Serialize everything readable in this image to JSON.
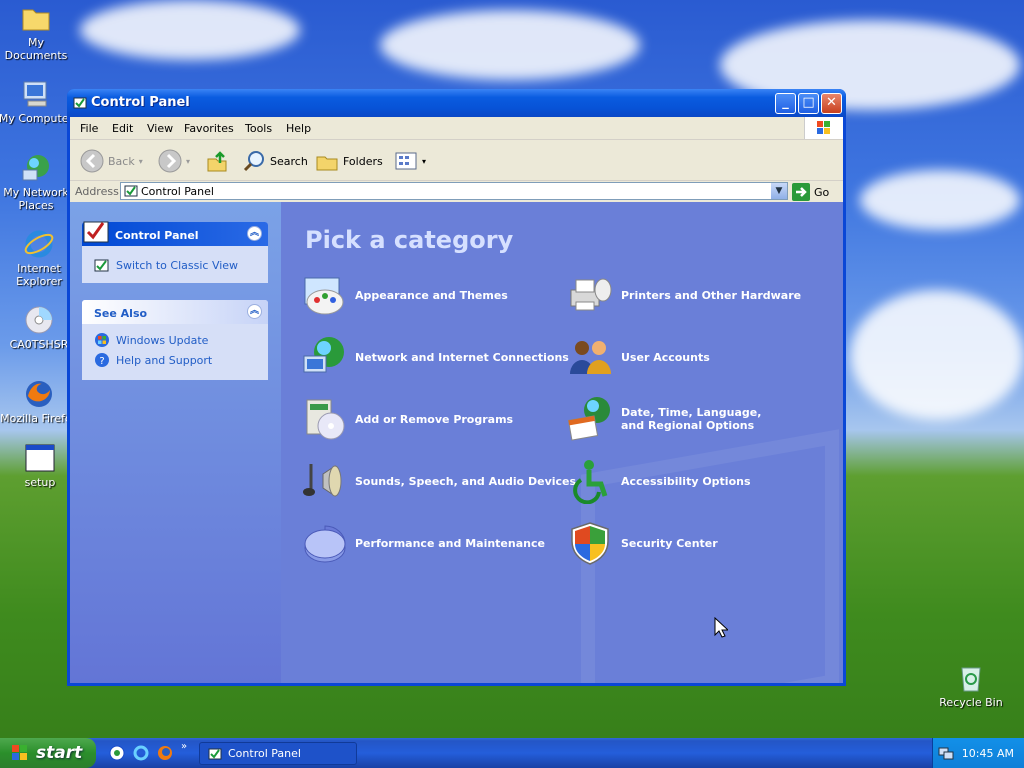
{
  "desktop": {
    "icons": [
      {
        "label": "My Documents"
      },
      {
        "label": "My Computer"
      },
      {
        "label": "My Network Places"
      },
      {
        "label": "Internet Explorer"
      },
      {
        "label": "CA0TSHSR"
      },
      {
        "label": "Mozilla Firefox"
      },
      {
        "label": "setup"
      },
      {
        "label": "Recycle Bin"
      }
    ]
  },
  "window": {
    "title": "Control Panel",
    "menu": [
      "File",
      "Edit",
      "View",
      "Favorites",
      "Tools",
      "Help"
    ],
    "toolbar": {
      "back": "Back",
      "search": "Search",
      "folders": "Folders"
    },
    "address": {
      "label": "Address",
      "value": "Control Panel",
      "go": "Go"
    },
    "left_pane": {
      "panel1_title": "Control Panel",
      "switch_link": "Switch to Classic View",
      "see_also_title": "See Also",
      "see_also_links": [
        "Windows Update",
        "Help and Support"
      ]
    },
    "main": {
      "heading": "Pick a category",
      "categories": [
        {
          "label": "Appearance and Themes",
          "icon": "appearance-icon"
        },
        {
          "label": "Printers and Other Hardware",
          "icon": "printer-icon"
        },
        {
          "label": "Network and Internet Connections",
          "icon": "network-icon"
        },
        {
          "label": "User Accounts",
          "icon": "users-icon"
        },
        {
          "label": "Add or Remove Programs",
          "icon": "add-remove-icon"
        },
        {
          "label": "Date, Time, Language, and Regional Options",
          "icon": "datetime-icon"
        },
        {
          "label": "Sounds, Speech, and Audio Devices",
          "icon": "sound-icon"
        },
        {
          "label": "Accessibility Options",
          "icon": "accessibility-icon"
        },
        {
          "label": "Performance and Maintenance",
          "icon": "performance-icon"
        },
        {
          "label": "Security Center",
          "icon": "shield-icon"
        }
      ]
    }
  },
  "taskbar": {
    "start_label": "start",
    "task_label": "Control Panel",
    "clock": "10:45 AM"
  }
}
